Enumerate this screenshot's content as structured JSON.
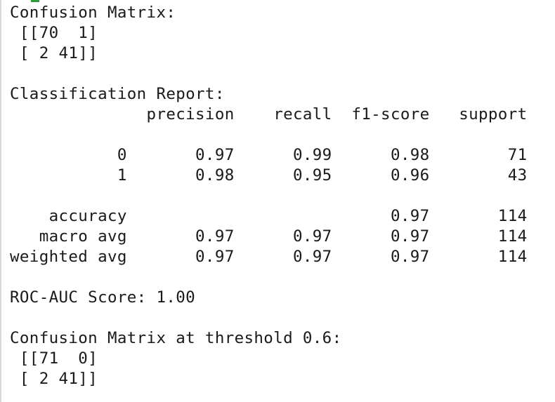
{
  "output": {
    "lines": [
      "Confusion Matrix:",
      " [[70  1]",
      " [ 2 41]]",
      "",
      "Classification Report:",
      "              precision    recall  f1-score   support",
      "",
      "           0       0.97      0.99      0.98        71",
      "           1       0.98      0.95      0.96        43",
      "",
      "    accuracy                           0.97       114",
      "   macro avg       0.97      0.97      0.97       114",
      "weighted avg       0.97      0.97      0.97       114",
      "",
      "ROC-AUC Score: 1.00",
      "",
      "Confusion Matrix at threshold 0.6:",
      " [[71  0]",
      " [ 2 41]]"
    ]
  },
  "colors": {
    "background": "#ffffff",
    "text": "#1a1a1a",
    "left_border": "#d9d9d9",
    "clipped_glyph_accent": "#2e9d3a"
  }
}
